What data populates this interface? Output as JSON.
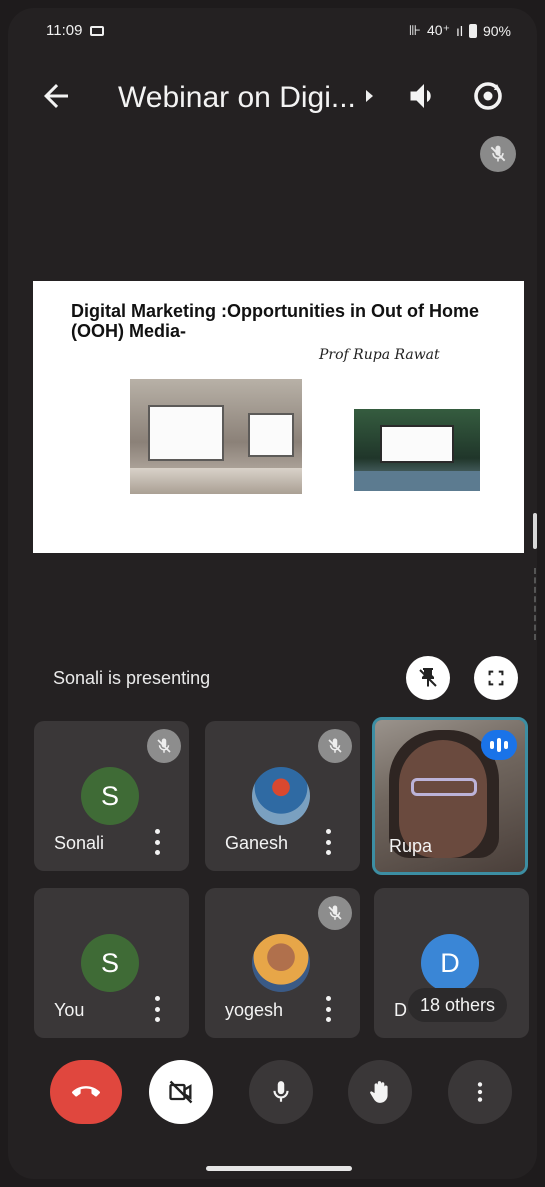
{
  "status_bar": {
    "time": "11:09",
    "network": "40⁺ ",
    "battery": "90%"
  },
  "header": {
    "title": "Webinar on Digi..."
  },
  "slide": {
    "title": "Digital Marketing :Opportunities in Out of Home (OOH) Media-",
    "author": "Prof Rupa Rawat"
  },
  "presenting_text": "Sonali is presenting",
  "participants": [
    {
      "name": "Sonali",
      "initial": "S",
      "avatar_color": "#3f6b36",
      "muted": true
    },
    {
      "name": "Ganesh",
      "muted": true
    },
    {
      "name": "Rupa",
      "speaking": true
    },
    {
      "name": "You",
      "initial": "S",
      "avatar_color": "#3f6b36",
      "muted": false
    },
    {
      "name": "yogesh",
      "muted": true
    },
    {
      "name": "D",
      "initial": "D",
      "avatar_color": "#3a86d6",
      "others_label": "18 others"
    }
  ],
  "colors": {
    "end_call": "#e0473e",
    "active_border": "#3c8ea3",
    "speaking": "#1a73e8"
  },
  "icons": [
    "back-arrow-icon",
    "speaker-icon",
    "switch-camera-icon",
    "mic-off-icon",
    "unpin-icon",
    "fullscreen-icon",
    "more-vert-icon",
    "end-call-icon",
    "camera-off-icon",
    "mic-icon",
    "raise-hand-icon"
  ]
}
